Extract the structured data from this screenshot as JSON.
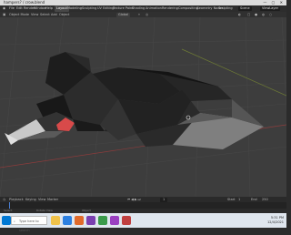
{
  "window": {
    "title": "hampers? / crow.blend",
    "controls": "— ▢ ✕"
  },
  "menubar": {
    "items": [
      "File",
      "Edit",
      "Render",
      "Window",
      "Help",
      "Layout",
      "Modeling",
      "Sculpting",
      "UV Editing",
      "Texture Paint",
      "Shading",
      "Animation",
      "Rendering",
      "Compositing",
      "Geometry Nodes",
      "Scripting"
    ],
    "active": "Layout",
    "scene_label": "Scene",
    "view_layer": "ViewLayer"
  },
  "toolbar": {
    "mode": "Object Mode",
    "view": "View",
    "select": "Select",
    "add": "Add",
    "object": "Object",
    "pivot": "Global"
  },
  "timeline": {
    "playback": "Playback",
    "keying": "Keying",
    "view": "View",
    "marker": "Marker",
    "frame_current": "1",
    "start_label": "Start",
    "start": "1",
    "end_label": "End",
    "end": "250"
  },
  "status": {
    "left": "Select",
    "middle": "Rotate View",
    "right": "Object"
  },
  "taskbar": {
    "search_placeholder": "Type here to search",
    "time": "5:31 PM",
    "date": "12/4/2021"
  }
}
